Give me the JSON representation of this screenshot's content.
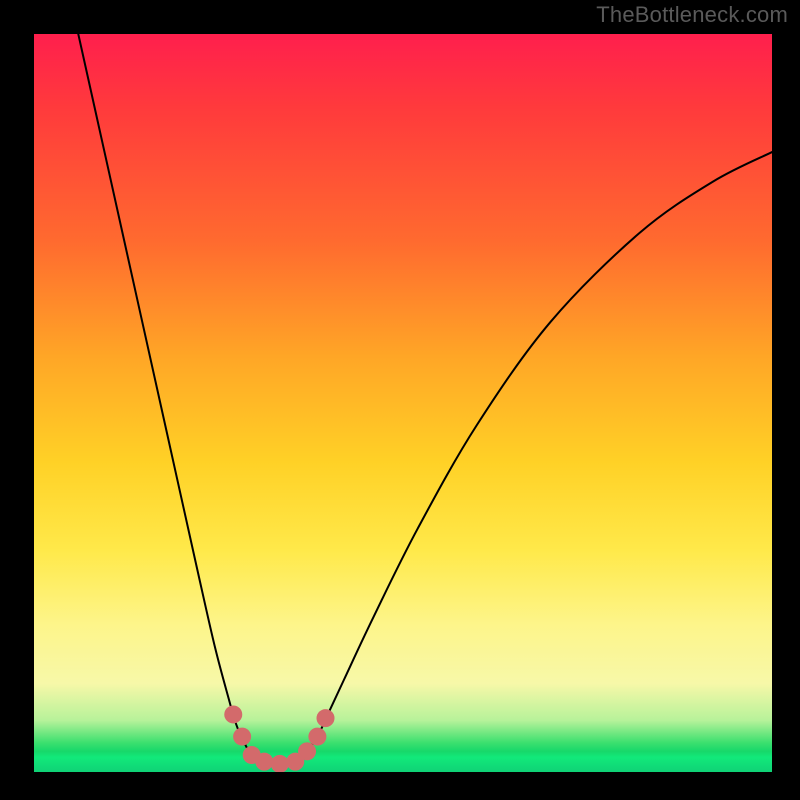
{
  "watermark": "TheBottleneck.com",
  "chart_data": {
    "type": "line",
    "title": "",
    "xlabel": "",
    "ylabel": "",
    "xlim": [
      0,
      100
    ],
    "ylim": [
      0,
      100
    ],
    "grid": false,
    "series": [
      {
        "name": "curve",
        "color": "#000000",
        "lineWidth": 2,
        "points": [
          {
            "x": 6.0,
            "y": 100.0
          },
          {
            "x": 10.0,
            "y": 82.0
          },
          {
            "x": 14.0,
            "y": 64.0
          },
          {
            "x": 18.0,
            "y": 46.0
          },
          {
            "x": 22.0,
            "y": 28.0
          },
          {
            "x": 24.5,
            "y": 17.0
          },
          {
            "x": 26.5,
            "y": 9.5
          },
          {
            "x": 27.2,
            "y": 7.0
          },
          {
            "x": 28.0,
            "y": 5.0
          },
          {
            "x": 29.5,
            "y": 2.2
          },
          {
            "x": 31.0,
            "y": 1.2
          },
          {
            "x": 32.5,
            "y": 0.8
          },
          {
            "x": 34.0,
            "y": 0.8
          },
          {
            "x": 35.5,
            "y": 1.4
          },
          {
            "x": 37.0,
            "y": 2.8
          },
          {
            "x": 38.0,
            "y": 4.2
          },
          {
            "x": 39.0,
            "y": 6.0
          },
          {
            "x": 40.0,
            "y": 8.2
          },
          {
            "x": 42.0,
            "y": 12.5
          },
          {
            "x": 46.0,
            "y": 21.0
          },
          {
            "x": 52.0,
            "y": 33.0
          },
          {
            "x": 60.0,
            "y": 47.0
          },
          {
            "x": 70.0,
            "y": 61.0
          },
          {
            "x": 82.0,
            "y": 73.0
          },
          {
            "x": 92.0,
            "y": 80.0
          },
          {
            "x": 100.0,
            "y": 84.0
          }
        ]
      }
    ],
    "markers": {
      "color": "#d36a6b",
      "radius_px": 9,
      "points": [
        {
          "x": 27.0,
          "y": 7.8
        },
        {
          "x": 28.2,
          "y": 4.8
        },
        {
          "x": 29.5,
          "y": 2.3
        },
        {
          "x": 31.2,
          "y": 1.4
        },
        {
          "x": 33.3,
          "y": 1.1
        },
        {
          "x": 35.4,
          "y": 1.4
        },
        {
          "x": 37.0,
          "y": 2.8
        },
        {
          "x": 38.4,
          "y": 4.8
        },
        {
          "x": 39.5,
          "y": 7.3
        }
      ]
    },
    "gradient_stops": [
      {
        "pos": 0.0,
        "color": "#ff1f4d"
      },
      {
        "pos": 0.1,
        "color": "#ff3a3c"
      },
      {
        "pos": 0.28,
        "color": "#ff6a2f"
      },
      {
        "pos": 0.44,
        "color": "#ffa726"
      },
      {
        "pos": 0.58,
        "color": "#ffd126"
      },
      {
        "pos": 0.7,
        "color": "#ffe94a"
      },
      {
        "pos": 0.8,
        "color": "#fdf58a"
      },
      {
        "pos": 0.88,
        "color": "#f7f8a8"
      },
      {
        "pos": 0.93,
        "color": "#b7f29a"
      },
      {
        "pos": 0.96,
        "color": "#3de06f"
      },
      {
        "pos": 0.98,
        "color": "#12e97a"
      },
      {
        "pos": 1.0,
        "color": "#0fd276"
      }
    ]
  }
}
